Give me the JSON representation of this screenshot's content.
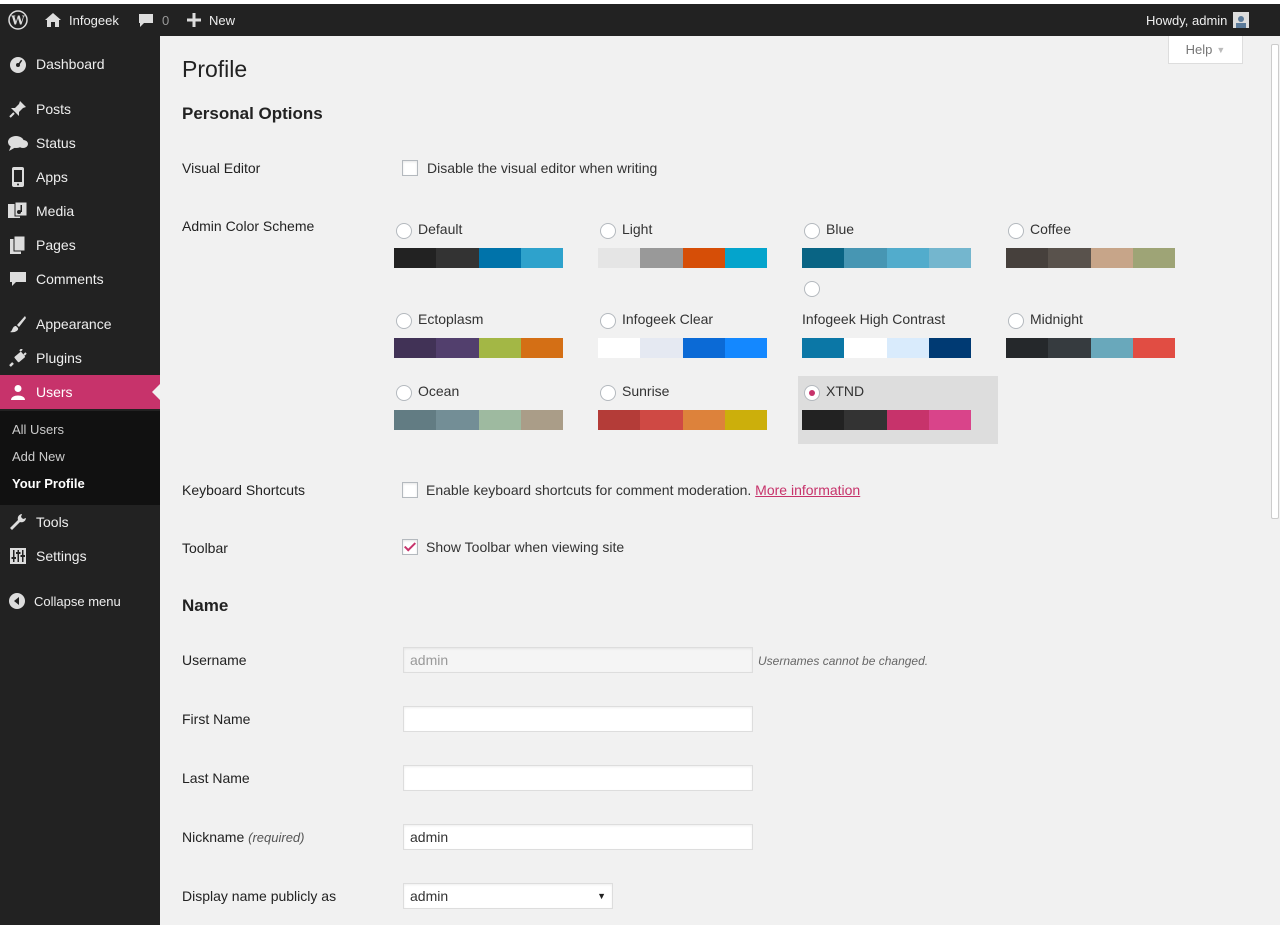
{
  "adminbar": {
    "site_name": "Infogeek",
    "comments_count": "0",
    "new_label": "New",
    "howdy": "Howdy, admin"
  },
  "sidebar": {
    "items": [
      {
        "label": "Dashboard",
        "icon": "dashboard-icon"
      },
      {
        "label": "Posts",
        "icon": "pin-icon"
      },
      {
        "label": "Status",
        "icon": "speech-bubbles-icon"
      },
      {
        "label": "Apps",
        "icon": "phone-icon"
      },
      {
        "label": "Media",
        "icon": "media-icon"
      },
      {
        "label": "Pages",
        "icon": "pages-icon"
      },
      {
        "label": "Comments",
        "icon": "comment-icon"
      },
      {
        "label": "Appearance",
        "icon": "brush-icon"
      },
      {
        "label": "Plugins",
        "icon": "plug-icon"
      },
      {
        "label": "Users",
        "icon": "user-icon"
      },
      {
        "label": "Tools",
        "icon": "wrench-icon"
      },
      {
        "label": "Settings",
        "icon": "settings-sliders-icon"
      }
    ],
    "submenu": [
      "All Users",
      "Add New",
      "Your Profile"
    ],
    "collapse_label": "Collapse menu",
    "accent": "#c7336b"
  },
  "help_label": "Help",
  "page": {
    "title": "Profile",
    "personal_options": "Personal Options",
    "visual_editor_label": "Visual Editor",
    "visual_editor_text": "Disable the visual editor when writing",
    "color_scheme_label": "Admin Color Scheme",
    "keyboard_label": "Keyboard Shortcuts",
    "keyboard_text": "Enable keyboard shortcuts for comment moderation.",
    "keyboard_link": "More information",
    "toolbar_label": "Toolbar",
    "toolbar_text": "Show Toolbar when viewing site",
    "name_heading": "Name",
    "username_label": "Username",
    "username_value": "admin",
    "username_note": "Usernames cannot be changed.",
    "first_name_label": "First Name",
    "last_name_label": "Last Name",
    "nickname_label": "Nickname",
    "nickname_required": "(required)",
    "nickname_value": "admin",
    "display_name_label": "Display name publicly as",
    "display_name_value": "admin"
  },
  "schemes": [
    {
      "name": "Default",
      "colors": [
        "#222222",
        "#333333",
        "#0073aa",
        "#2ea2cc"
      ],
      "selected": false
    },
    {
      "name": "Light",
      "colors": [
        "#e5e5e5",
        "#999999",
        "#d64e07",
        "#04a4cc"
      ],
      "selected": false
    },
    {
      "name": "Blue",
      "colors": [
        "#096484",
        "#4796b3",
        "#52accc",
        "#74b6ce"
      ],
      "selected": false
    },
    {
      "name": "Coffee",
      "colors": [
        "#46403c",
        "#59524c",
        "#c7a589",
        "#9ea476"
      ],
      "selected": false
    },
    {
      "name": "Ectoplasm",
      "colors": [
        "#413256",
        "#523f6d",
        "#a3b745",
        "#d46f15"
      ],
      "selected": false
    },
    {
      "name": "Infogeek Clear",
      "colors": [
        "#ffffff",
        "#e5e9f2",
        "#0b6ad6",
        "#1488ff"
      ],
      "selected": false
    },
    {
      "name": "Infogeek High Contrast",
      "colors": [
        "#0b77a6",
        "#ffffff",
        "#d9ebfc",
        "#003a73"
      ],
      "selected": false
    },
    {
      "name": "Midnight",
      "colors": [
        "#25282b",
        "#363b3f",
        "#69a8bb",
        "#e14d43"
      ],
      "selected": false
    },
    {
      "name": "Ocean",
      "colors": [
        "#627c83",
        "#738e96",
        "#9ebaa0",
        "#aa9d88"
      ],
      "selected": false
    },
    {
      "name": "Sunrise",
      "colors": [
        "#b43c38",
        "#cf4944",
        "#dd823b",
        "#ccaf0b"
      ],
      "selected": false
    },
    {
      "name": "XTND",
      "colors": [
        "#222222",
        "#333333",
        "#c7336b",
        "#d9448a"
      ],
      "selected": true
    }
  ]
}
